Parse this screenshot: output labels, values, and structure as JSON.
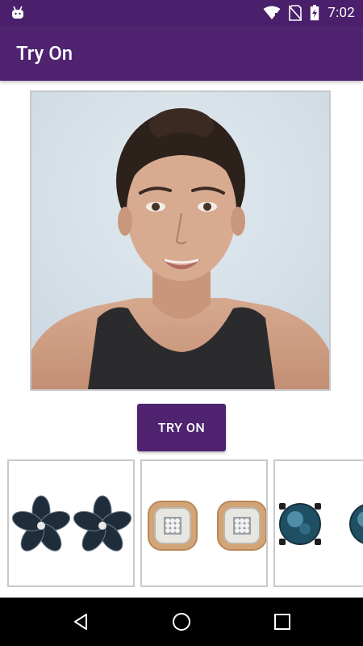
{
  "status_bar": {
    "time": "7:02",
    "icons": [
      "android-notification-icon",
      "wifi-icon",
      "no-sim-icon",
      "battery-charging-icon"
    ]
  },
  "app_bar": {
    "title": "Try On"
  },
  "main": {
    "photo_alt": "model-face-photo",
    "try_on_button": "TRY ON"
  },
  "products": [
    {
      "name": "black-diamond-flower-earrings",
      "icon": "flower-earring-icon"
    },
    {
      "name": "gold-cushion-diamond-earrings",
      "icon": "cushion-earring-icon"
    },
    {
      "name": "blue-round-stud-earrings",
      "icon": "round-stud-icon"
    }
  ],
  "nav_bar": {
    "buttons": [
      "back-icon",
      "home-icon",
      "recents-icon"
    ]
  },
  "colors": {
    "primary": "#4f2370",
    "status_bar": "#4a1f6b",
    "card_border": "#c9c9c9"
  }
}
